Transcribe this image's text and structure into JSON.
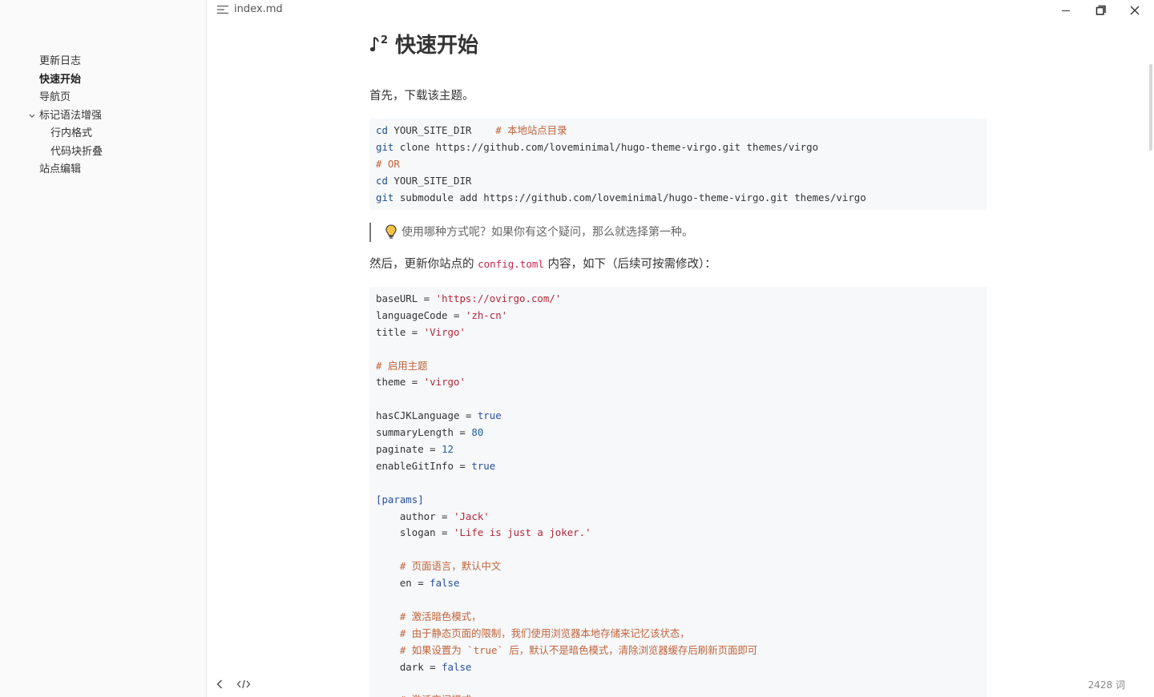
{
  "window": {
    "file_name": "index.md"
  },
  "toc": [
    {
      "label": "更新日志",
      "level": 1,
      "active": false
    },
    {
      "label": "快速开始",
      "level": 1,
      "active": true
    },
    {
      "label": "导航页",
      "level": 1,
      "active": false
    },
    {
      "label": "标记语法增强",
      "level": 1,
      "active": false,
      "expanded": true
    },
    {
      "label": "行内格式",
      "level": 2,
      "active": false
    },
    {
      "label": "代码块折叠",
      "level": 2,
      "active": false
    },
    {
      "label": "站点编辑",
      "level": 1,
      "active": false
    }
  ],
  "doc": {
    "heading": "快速开始",
    "intro": "首先，下载该主题。",
    "code1": [
      [
        {
          "t": "kw",
          "v": "cd"
        },
        {
          "t": "",
          "v": " YOUR_SITE_DIR    "
        },
        {
          "t": "cmt",
          "v": "# 本地站点目录"
        }
      ],
      [
        {
          "t": "kw",
          "v": "git"
        },
        {
          "t": "",
          "v": " clone https://github.com/loveminimal/hugo-theme-virgo.git themes/virgo"
        }
      ],
      [
        {
          "t": "cmt",
          "v": "# OR"
        }
      ],
      [
        {
          "t": "kw",
          "v": "cd"
        },
        {
          "t": "",
          "v": " YOUR_SITE_DIR"
        }
      ],
      [
        {
          "t": "kw",
          "v": "git"
        },
        {
          "t": "",
          "v": " submodule add https://github.com/loveminimal/hugo-theme-virgo.git themes/virgo"
        }
      ]
    ],
    "tip": "使用哪种方式呢？如果你有这个疑问，那么就选择第一种。",
    "then_before": "然后，更新你站点的 ",
    "then_code": "config.toml",
    "then_after": " 内容，如下（后续可按需修改）：",
    "code2": [
      [
        {
          "t": "",
          "v": "baseURL = "
        },
        {
          "t": "str",
          "v": "'https://ovirgo.com/'"
        }
      ],
      [
        {
          "t": "",
          "v": "languageCode = "
        },
        {
          "t": "str",
          "v": "'zh-cn'"
        }
      ],
      [
        {
          "t": "",
          "v": "title = "
        },
        {
          "t": "str",
          "v": "'Virgo'"
        }
      ],
      [
        {
          "t": "",
          "v": ""
        }
      ],
      [
        {
          "t": "cmt",
          "v": "# 启用主题"
        }
      ],
      [
        {
          "t": "",
          "v": "theme = "
        },
        {
          "t": "str",
          "v": "'virgo'"
        }
      ],
      [
        {
          "t": "",
          "v": ""
        }
      ],
      [
        {
          "t": "",
          "v": "hasCJKLanguage = "
        },
        {
          "t": "bool",
          "v": "true"
        }
      ],
      [
        {
          "t": "",
          "v": "summaryLength = "
        },
        {
          "t": "num",
          "v": "80"
        }
      ],
      [
        {
          "t": "",
          "v": "paginate = "
        },
        {
          "t": "num",
          "v": "12"
        }
      ],
      [
        {
          "t": "",
          "v": "enableGitInfo = "
        },
        {
          "t": "bool",
          "v": "true"
        }
      ],
      [
        {
          "t": "",
          "v": ""
        }
      ],
      [
        {
          "t": "sect",
          "v": "[params]"
        }
      ],
      [
        {
          "t": "",
          "v": "    author = "
        },
        {
          "t": "str",
          "v": "'Jack'"
        }
      ],
      [
        {
          "t": "",
          "v": "    slogan = "
        },
        {
          "t": "str",
          "v": "'Life is just a joker.'"
        }
      ],
      [
        {
          "t": "",
          "v": ""
        }
      ],
      [
        {
          "t": "cmt",
          "v": "    # 页面语言，默认中文"
        }
      ],
      [
        {
          "t": "",
          "v": "    en = "
        },
        {
          "t": "bool",
          "v": "false"
        }
      ],
      [
        {
          "t": "",
          "v": ""
        }
      ],
      [
        {
          "t": "cmt",
          "v": "    # 激活暗色模式，"
        }
      ],
      [
        {
          "t": "cmt",
          "v": "    # 由于静态页面的限制，我们使用浏览器本地存储来记忆该状态，"
        }
      ],
      [
        {
          "t": "cmt",
          "v": "    # 如果设置为 `true` 后，默认不是暗色模式，清除浏览器缓存后刷新页面即可"
        }
      ],
      [
        {
          "t": "",
          "v": "    dark = "
        },
        {
          "t": "bool",
          "v": "false"
        }
      ],
      [
        {
          "t": "",
          "v": ""
        }
      ],
      [
        {
          "t": "cmt",
          "v": "    # 激活夜间模式"
        }
      ]
    ]
  },
  "status": {
    "word_count": "2428 词"
  },
  "icons": {
    "menu": "list-menu-icon",
    "minimize": "minimize-icon",
    "maximize": "restore-icon",
    "close": "close-icon",
    "back": "chevron-left-icon",
    "source": "code-icon",
    "bulb": "lightbulb-icon",
    "heading": "music-note-icon"
  }
}
